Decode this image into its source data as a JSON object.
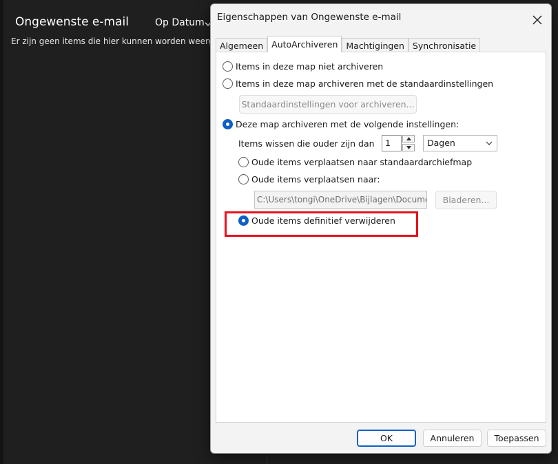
{
  "background": {
    "folder_title": "Ongewenste e-mail",
    "sort_label": "Op Datum",
    "empty_message": "Er zijn geen items die hier kunnen worden weergegeven."
  },
  "dialog": {
    "title": "Eigenschappen van Ongewenste e-mail",
    "tabs": [
      {
        "label": "Algemeen",
        "active": false
      },
      {
        "label": "AutoArchiveren",
        "active": true
      },
      {
        "label": "Machtigingen",
        "active": false
      },
      {
        "label": "Synchronisatie",
        "active": false
      }
    ],
    "options": {
      "no_archive": "Items in deze map niet archiveren",
      "default_archive": "Items in deze map archiveren met de standaardinstellingen",
      "default_settings_button": "Standaardinstellingen voor archiveren...",
      "custom_archive": "Deze map archiveren met de volgende instellingen:",
      "clean_older_label": "Items wissen die ouder zijn dan",
      "age_value": "1",
      "age_unit": "Dagen",
      "move_default": "Oude items verplaatsen naar standaardarchiefmap",
      "move_to": "Oude items verplaatsen naar:",
      "path_value": "C:\\Users\\tongi\\OneDrive\\Bijlagen\\Documenten",
      "browse_button": "Bladeren...",
      "delete_permanent": "Oude items definitief verwijderen"
    },
    "buttons": {
      "ok": "OK",
      "cancel": "Annuleren",
      "apply": "Toepassen"
    }
  },
  "colors": {
    "accent": "#0f5fc7",
    "highlight": "#e8101c"
  }
}
